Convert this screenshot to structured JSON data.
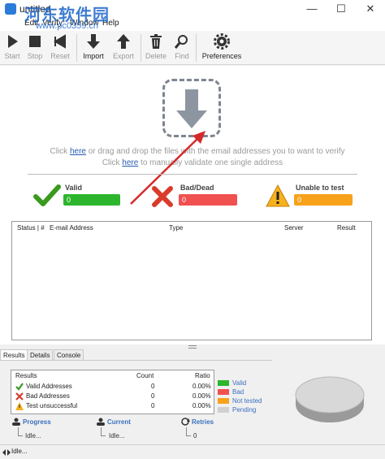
{
  "window": {
    "title": "untitled",
    "minimize": "—",
    "maximize": "☐",
    "close": "✕"
  },
  "watermark": {
    "text": "河东软件园",
    "url": "www.pc0359.cn"
  },
  "menu": [
    "Edit",
    "Verify",
    "Window",
    "Help"
  ],
  "toolbar": {
    "start": "Start",
    "stop": "Stop",
    "reset": "Reset",
    "import": "Import",
    "export": "Export",
    "delete": "Delete",
    "find": "Find",
    "preferences": "Preferences"
  },
  "hint": {
    "click1": "Click ",
    "here1": "here",
    "rest1": " or drag and drop the files with the email addresses you to want to verify",
    "click2": "Click ",
    "here2": "here",
    "rest2": " to manually validate one single address"
  },
  "stats": {
    "valid": {
      "label": "Valid",
      "count": "0",
      "color": "#2db52d"
    },
    "bad": {
      "label": "Bad/Dead",
      "count": "0",
      "color": "#f05050"
    },
    "unable": {
      "label": "Unable to test",
      "count": "0",
      "color": "#f7a21a"
    }
  },
  "table": {
    "columns": [
      "Status | #",
      "E-mail Address",
      "Type",
      "Server",
      "Result"
    ]
  },
  "tabs": [
    "Results",
    "Details",
    "Console"
  ],
  "results": {
    "headers": [
      "Results",
      "Count",
      "Ratio"
    ],
    "rows": [
      {
        "label": "Valid Addresses",
        "count": "0",
        "ratio": "0.00%"
      },
      {
        "label": "Bad Addresses",
        "count": "0",
        "ratio": "0.00%"
      },
      {
        "label": "Test unsuccessful",
        "count": "0",
        "ratio": "0.00%"
      }
    ]
  },
  "legend": [
    {
      "label": "Valid",
      "color": "#2db52d"
    },
    {
      "label": "Bad",
      "color": "#f05050"
    },
    {
      "label": "Not tested",
      "color": "#f7a21a"
    },
    {
      "label": "Pending",
      "color": "#d0d0d0"
    }
  ],
  "progress": {
    "title": "Progress",
    "value": "Idle..."
  },
  "current": {
    "title": "Current",
    "value": "Idle..."
  },
  "retries": {
    "title": "Retries",
    "value": "0"
  },
  "status": {
    "text": "Idle..."
  }
}
